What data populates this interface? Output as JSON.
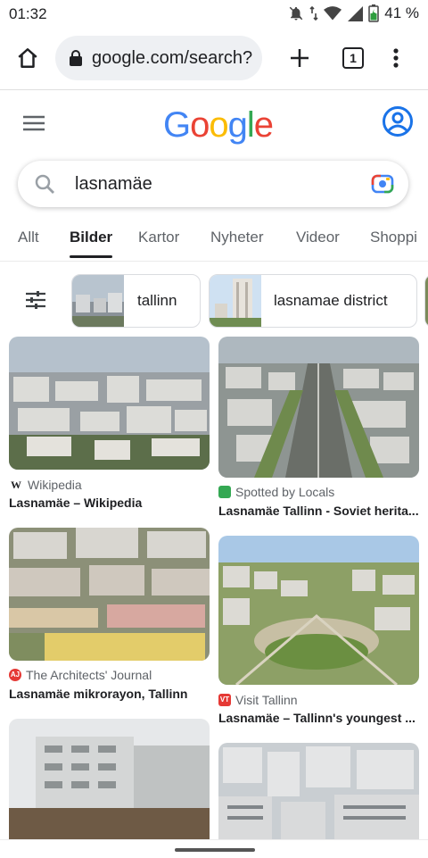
{
  "status": {
    "time": "01:32",
    "battery": "41 %"
  },
  "browser": {
    "url": "google.com/search?",
    "tab_count": "1"
  },
  "logo": {
    "letters": [
      "G",
      "o",
      "o",
      "g",
      "l",
      "e"
    ],
    "colors": [
      "#4285F4",
      "#EA4335",
      "#FBBC05",
      "#4285F4",
      "#34A853",
      "#EA4335"
    ]
  },
  "search": {
    "query": "lasnamäe"
  },
  "tabs": [
    "Allt",
    "Bilder",
    "Kartor",
    "Nyheter",
    "Videor",
    "Shoppi"
  ],
  "chips": [
    "tallinn",
    "lasnamae district"
  ],
  "results": [
    {
      "source": "Wikipedia",
      "title": "Lasnamäe – Wikipedia"
    },
    {
      "source": "Spotted by Locals",
      "title": "Lasnamäe Tallinn - Soviet herita..."
    },
    {
      "source": "The Architects' Journal",
      "title": "Lasnamäe mikrorayon, Tallinn"
    },
    {
      "source": "Visit Tallinn",
      "title": "Lasnamäe – Tallinn's youngest ..."
    }
  ],
  "favicons": {
    "aj": "AJ",
    "vt": "VT",
    "wiki": "W"
  }
}
